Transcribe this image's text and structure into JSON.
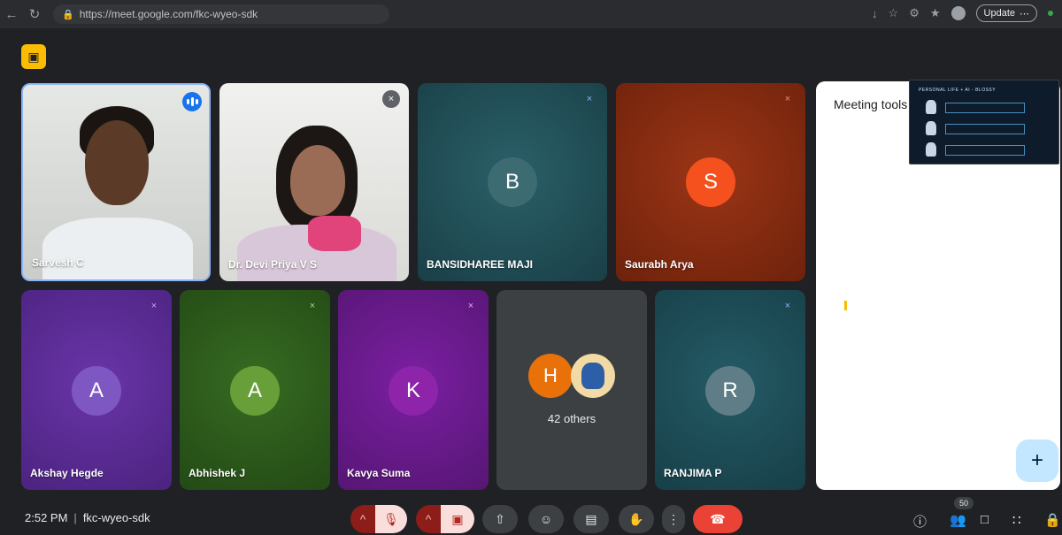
{
  "browser": {
    "url": "https://meet.google.com/fkc-wyeo-sdk",
    "update_label": "Update"
  },
  "tiles": [
    {
      "name": "Sarvesh C",
      "type": "video"
    },
    {
      "name": "Dr. Devi Priya V S",
      "type": "video"
    },
    {
      "name": "BANSIDHAREE MAJI",
      "initial": "B",
      "bg": "#1f4d55",
      "avatar_bg": "#2f5e66"
    },
    {
      "name": "Saurabh Arya",
      "initial": "S",
      "bg": "#8a2a12",
      "avatar_bg": "#f4511e"
    },
    {
      "name": "Akshay Hegde",
      "initial": "A",
      "bg": "#5e2d98",
      "avatar_bg": "#7e57c2"
    },
    {
      "name": "Abhishek J",
      "initial": "A",
      "bg": "#2f5e1e",
      "avatar_bg": "#689f38"
    },
    {
      "name": "Kavya Suma",
      "initial": "K",
      "bg": "#6a1b8a",
      "avatar_bg": "#8e24aa"
    },
    {
      "name": "42 others",
      "initial": "H",
      "bg": "#3c4043",
      "avatar_bg": "#e8710a"
    },
    {
      "name": "RANJIMA P",
      "initial": "R",
      "bg": "#1d4f5a",
      "avatar_bg": "#5f7d86"
    }
  ],
  "side_panel": {
    "title": "Meeting tools"
  },
  "presentation_preview": {
    "title": "PERSONAL LIFE + AI - BLOSSY"
  },
  "bottom_bar": {
    "time": "2:52 PM",
    "meeting_code": "fkc-wyeo-sdk",
    "participant_count": "50"
  },
  "colors": {
    "background": "#202124",
    "accent_blue": "#1a73e8",
    "end_call_red": "#ea4335"
  }
}
